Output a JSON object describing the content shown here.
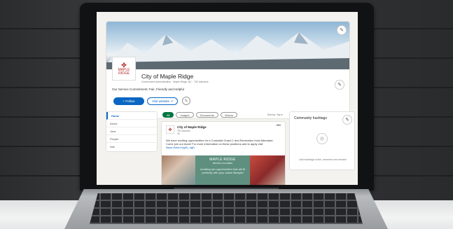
{
  "company": {
    "name": "City of Maple Ridge",
    "subtitle": "Government Administration · Maple Ridge, BC · 752 followers",
    "tagline": "Our Service Commitment: Fair, Friendly and Helpful",
    "logo_text_1": "MAPLE",
    "logo_text_2": "RIDGE",
    "follow_label": "+ Follow",
    "visit_label": "Visit website ↗"
  },
  "nav": {
    "items": [
      {
        "label": "Home"
      },
      {
        "label": "About"
      },
      {
        "label": "Jobs"
      },
      {
        "label": "People"
      },
      {
        "label": "Ads"
      }
    ]
  },
  "filters": {
    "chips": [
      {
        "label": "All"
      },
      {
        "label": "Images"
      },
      {
        "label": "Documents"
      },
      {
        "label": "Videos"
      }
    ],
    "sort_label": "Sort by: Top ▾"
  },
  "post": {
    "author": "City of Maple Ridge",
    "followers": "752 followers",
    "age": "3d",
    "text": "We have exciting opportunities for a Custodial Guard 1 and Recreation Host Attendant. Come join our team! For more information on these positions and to apply visit",
    "link": "https://lnkd.in/gZk_4gD",
    "image_brand": "MAPLE RIDGE",
    "image_region": "BRITISH COLUMBIA",
    "image_copy": "Auxiliary job opportunities that will fit perfectly with your active lifestyle!"
  },
  "hashtags": {
    "title": "Community hashtags",
    "note": "Add hashtags to like, comment and reshare"
  },
  "colors": {
    "primary": "#0a66c2",
    "chip_active": "#057642",
    "brand_red": "#b42a25"
  }
}
